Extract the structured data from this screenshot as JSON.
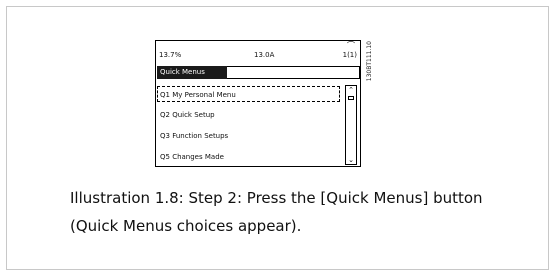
{
  "display": {
    "status_left": "13.7%",
    "status_mid": "13.0A",
    "status_right": "1(1)",
    "active_tab": "Quick Menus",
    "menu_items": [
      "Q1 My Personal Menu",
      "Q2 Quick Setup",
      "Q3 Function Setups",
      "Q5 Changes Made"
    ],
    "selected_index": 0
  },
  "figure_id": "130BT111.10",
  "caption": {
    "line1": "Illustration 1.8: Step 2: Press the [Quick Menus] button",
    "line2": "(Quick Menus choices appear)."
  }
}
